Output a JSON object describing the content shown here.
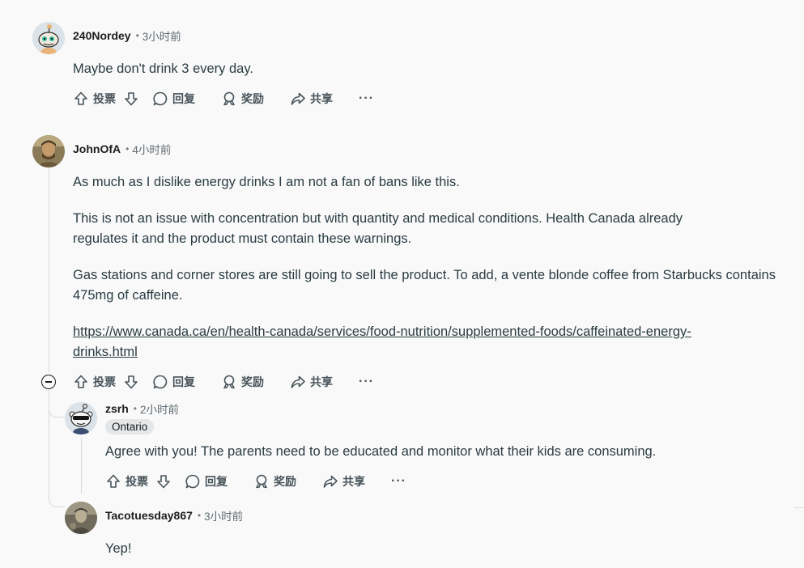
{
  "comments": [
    {
      "user": "240Nordey",
      "time": "3小时前",
      "paragraphs": [
        "Maybe don't drink 3 every day."
      ]
    },
    {
      "user": "JohnOfA",
      "time": "4小时前",
      "paragraphs": [
        "As much as I dislike energy drinks I am not a fan of bans like this.",
        "This is not an issue with concentration but with quantity and medical conditions. Health Canada already regulates it and the product must contain these warnings.",
        "Gas stations and corner stores are still going to sell the product. To add, a vente blonde coffee from Starbucks contains 475mg of caffeine."
      ],
      "link": "https://www.canada.ca/en/health-canada/services/food-nutrition/supplemented-foods/caffeinated-energy-drinks.html",
      "link_lines": [
        "https://www.canada.ca/en/health-canada/services/food-nutrition/supplemented-foods/caffeinated-energy-",
        "drinks.html"
      ]
    },
    {
      "user": "zsrh",
      "time": "2小时前",
      "flair": "Ontario",
      "paragraphs": [
        "Agree with you! The parents need to be educated and monitor what their kids are consuming."
      ]
    },
    {
      "user": "Tacotuesday867",
      "time": "3小时前",
      "paragraphs": [
        "Yep!"
      ]
    }
  ],
  "actions": {
    "vote": "投票",
    "reply": "回复",
    "award": "奖励",
    "share": "共享",
    "more": "···"
  },
  "meta_separator": "•",
  "icons": {
    "upvote": "upvote-arrow-icon",
    "downvote": "downvote-arrow-icon",
    "reply": "comment-bubble-icon",
    "award": "award-medal-icon",
    "share": "share-arrow-icon",
    "collapse": "minus-circle-icon"
  }
}
